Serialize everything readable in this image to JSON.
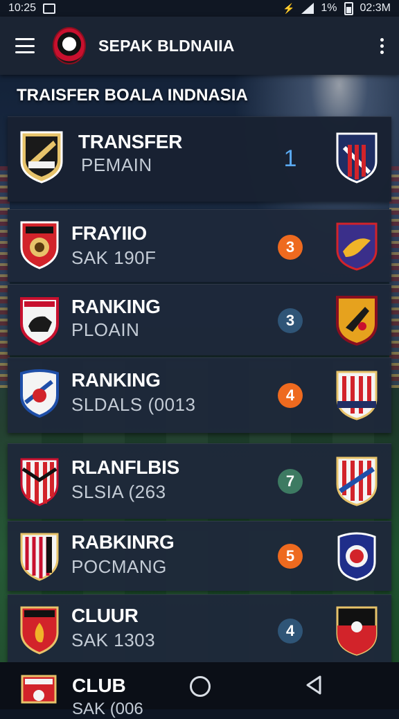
{
  "status_bar": {
    "time_left": "10:25",
    "battery": "1%",
    "time_right": "02:3M"
  },
  "app_bar": {
    "title": "SEPAK BLDNAIIA"
  },
  "section_title": "TRAISFER BOALA INDNASIA",
  "items": [
    {
      "title": "TRANSFER",
      "subtitle": "PEMAIN",
      "badge": "1",
      "badge_color": "",
      "crest_left": "black-gold-shield",
      "crest_right": "navy-red-striped-shield"
    },
    {
      "title": "FRAYIIO",
      "subtitle": "SAK 190F",
      "badge": "3",
      "badge_color": "#ee6a1f",
      "crest_left": "red-white-lion-shield",
      "crest_right": "purple-eagle-shield"
    },
    {
      "title": "RANKING",
      "subtitle": "PLOAIN",
      "badge": "3",
      "badge_color": "#2f5577",
      "crest_left": "white-bull-shield",
      "crest_right": "orange-eagle-shield"
    },
    {
      "title": "RANKING",
      "subtitle": "SLDALS (0013",
      "badge": "4",
      "badge_color": "#ee6a1f",
      "crest_left": "white-blue-shield",
      "crest_right": "red-striped-gold-shield"
    },
    {
      "title": "RLANFLBIS",
      "subtitle": "SLSIA (263",
      "badge": "7",
      "badge_color": "#3d7a62",
      "crest_left": "red-white-striped-shield",
      "crest_right": "red-white-blue-shield"
    },
    {
      "title": "RABKINRG",
      "subtitle": "POCMANG",
      "badge": "5",
      "badge_color": "#ee6a1f",
      "crest_left": "red-black-striped-shield",
      "crest_right": "blue-red-round-crest"
    },
    {
      "title": "CLUUR",
      "subtitle": "SAK 1303",
      "badge": "4",
      "badge_color": "#2f5577",
      "crest_left": "red-black-flame-shield",
      "crest_right": "black-red-gold-shield"
    }
  ],
  "nav_bar": {
    "partial_item_title": "CLUB",
    "partial_item_subtitle": "SAK (006"
  },
  "colors": {
    "accent_blue": "#5aa9f0",
    "badge_orange": "#ee6a1f",
    "badge_navy": "#2f5577",
    "badge_green": "#3d7a62",
    "card_bg": "#1e283a"
  }
}
